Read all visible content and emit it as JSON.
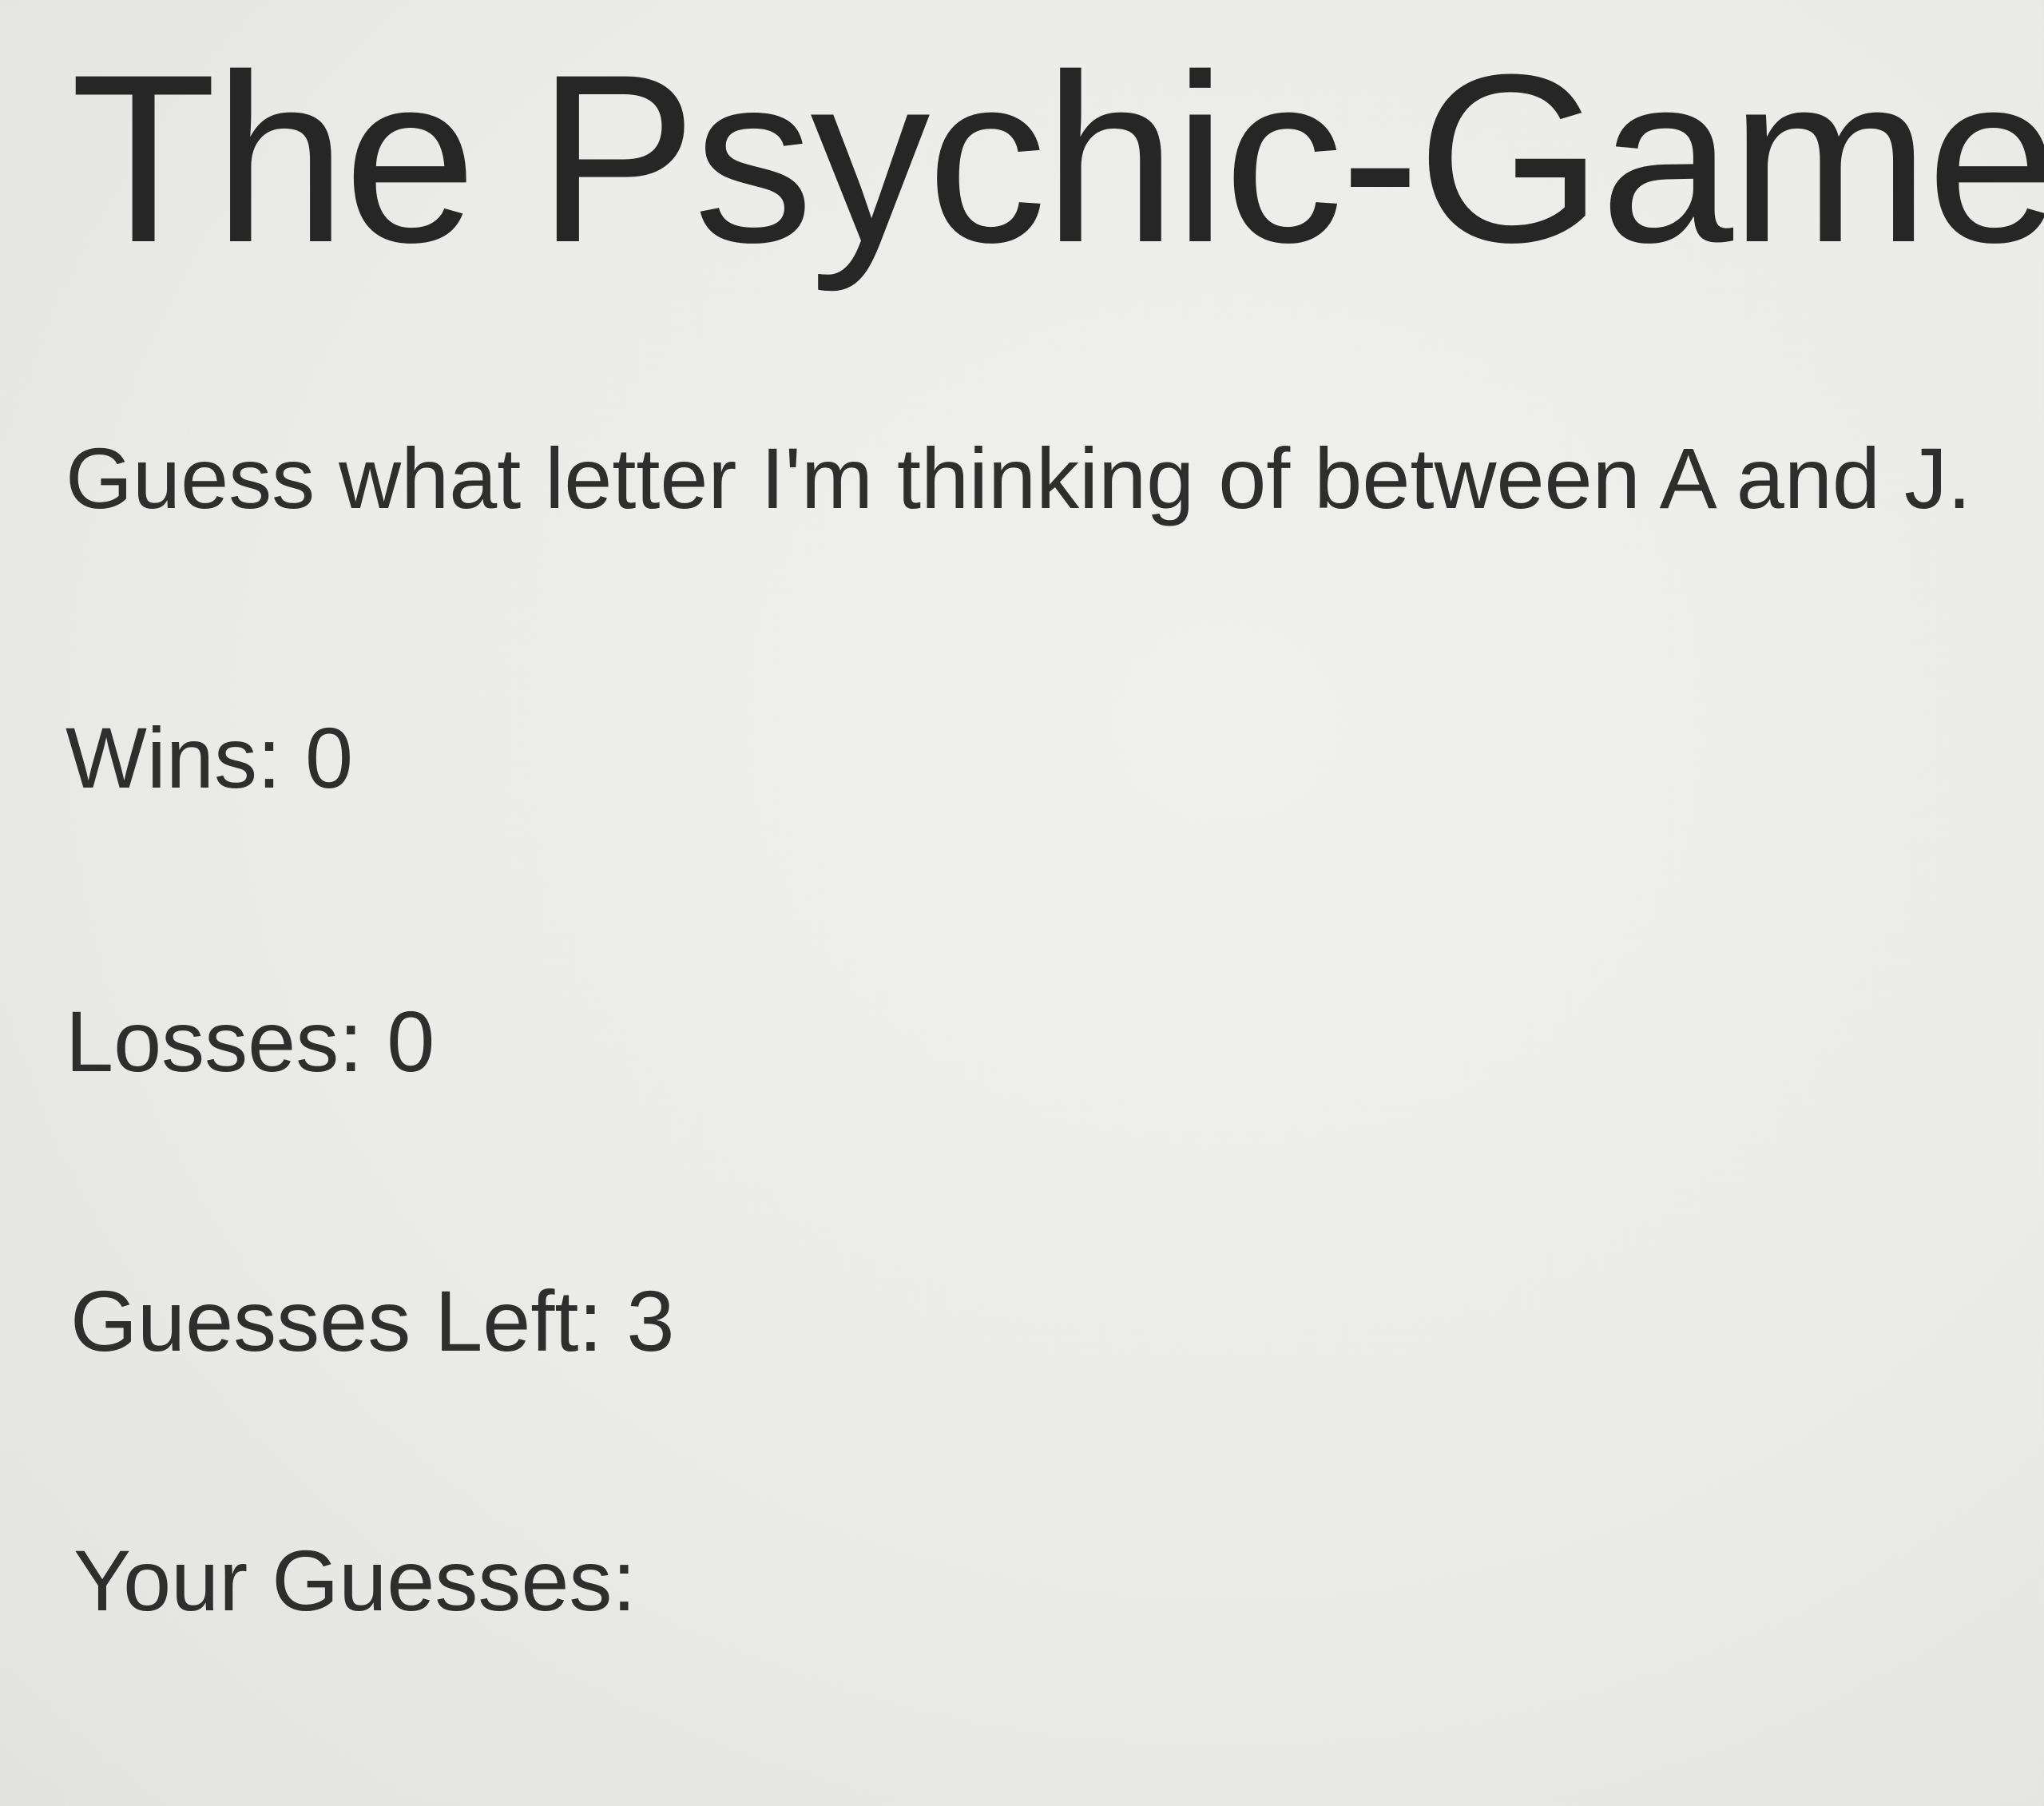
{
  "game": {
    "title": "The Psychic-Game.",
    "instructions": "Guess what letter I'm thinking of between A and J.",
    "wins_label": "Wins:",
    "wins_value": "0",
    "losses_label": "Losses:",
    "losses_value": "0",
    "guesses_left_label": "Guesses Left:",
    "guesses_left_value": "3",
    "your_guesses_label": "Your Guesses:",
    "your_guesses_value": ""
  }
}
